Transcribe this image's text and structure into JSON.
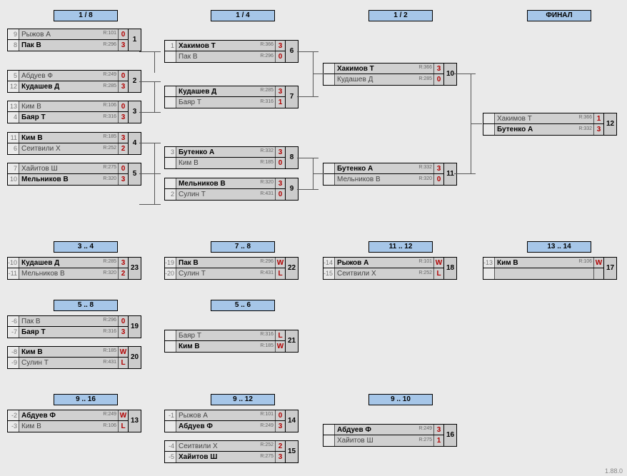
{
  "version": "1.88.0",
  "rounds": {
    "r18": "1 / 8",
    "r14": "1 / 4",
    "r12": "1 / 2",
    "final": "ФИНАЛ",
    "b34": "3 .. 4",
    "b78": "7 .. 8",
    "b1112": "11 .. 12",
    "b1314": "13 .. 14",
    "b58": "5 .. 8",
    "b56": "5 .. 6",
    "b916": "9 .. 16",
    "b912": "9 .. 12",
    "b910": "9 .. 10"
  },
  "matches": {
    "m1": {
      "num": "1",
      "p1": {
        "seed": "9",
        "name": "Рыжов А",
        "r": "R:101",
        "sc": "0",
        "w": false
      },
      "p2": {
        "seed": "8",
        "name": "Пак В",
        "r": "R:296",
        "sc": "3",
        "w": true
      }
    },
    "m2": {
      "num": "2",
      "p1": {
        "seed": "5",
        "name": "Абдуев Ф",
        "r": "R:249",
        "sc": "0",
        "w": false
      },
      "p2": {
        "seed": "12",
        "name": "Кудашев Д",
        "r": "R:285",
        "sc": "3",
        "w": true
      }
    },
    "m3": {
      "num": "3",
      "p1": {
        "seed": "13",
        "name": "Ким В",
        "r": "R:106",
        "sc": "0",
        "w": false
      },
      "p2": {
        "seed": "4",
        "name": "Баяр Т",
        "r": "R:316",
        "sc": "3",
        "w": true
      }
    },
    "m4": {
      "num": "4",
      "p1": {
        "seed": "11",
        "name": "Ким В",
        "r": "R:185",
        "sc": "3",
        "w": true
      },
      "p2": {
        "seed": "6",
        "name": "Сеитвили Х",
        "r": "R:252",
        "sc": "2",
        "w": false
      }
    },
    "m5": {
      "num": "5",
      "p1": {
        "seed": "7",
        "name": "Хайитов Ш",
        "r": "R:275",
        "sc": "0",
        "w": false
      },
      "p2": {
        "seed": "10",
        "name": "Мельников В",
        "r": "R:320",
        "sc": "3",
        "w": true
      }
    },
    "m6": {
      "num": "6",
      "p1": {
        "seed": "1",
        "name": "Хакимов Т",
        "r": "R:366",
        "sc": "3",
        "w": true
      },
      "p2": {
        "seed": "",
        "name": "Пак В",
        "r": "R:296",
        "sc": "0",
        "w": false
      }
    },
    "m7": {
      "num": "7",
      "p1": {
        "seed": "",
        "name": "Кудашев Д",
        "r": "R:285",
        "sc": "3",
        "w": true
      },
      "p2": {
        "seed": "",
        "name": "Баяр Т",
        "r": "R:316",
        "sc": "1",
        "w": false
      }
    },
    "m8": {
      "num": "8",
      "p1": {
        "seed": "3",
        "name": "Бутенко А",
        "r": "R:332",
        "sc": "3",
        "w": true
      },
      "p2": {
        "seed": "",
        "name": "Ким В",
        "r": "R:185",
        "sc": "0",
        "w": false
      }
    },
    "m9": {
      "num": "9",
      "p1": {
        "seed": "",
        "name": "Мельников В",
        "r": "R:320",
        "sc": "3",
        "w": true
      },
      "p2": {
        "seed": "2",
        "name": "Сулин Т",
        "r": "R:431",
        "sc": "0",
        "w": false
      }
    },
    "m10": {
      "num": "10",
      "p1": {
        "seed": "",
        "name": "Хакимов Т",
        "r": "R:366",
        "sc": "3",
        "w": true
      },
      "p2": {
        "seed": "",
        "name": "Кудашев Д",
        "r": "R:285",
        "sc": "0",
        "w": false
      }
    },
    "m11": {
      "num": "11",
      "p1": {
        "seed": "",
        "name": "Бутенко А",
        "r": "R:332",
        "sc": "3",
        "w": true
      },
      "p2": {
        "seed": "",
        "name": "Мельников В",
        "r": "R:320",
        "sc": "0",
        "w": false
      }
    },
    "m12": {
      "num": "12",
      "p1": {
        "seed": "",
        "name": "Хакимов Т",
        "r": "R:366",
        "sc": "1",
        "w": false
      },
      "p2": {
        "seed": "",
        "name": "Бутенко А",
        "r": "R:332",
        "sc": "3",
        "w": true
      }
    },
    "m13": {
      "num": "13",
      "p1": {
        "seed": "-2",
        "name": "Абдуев Ф",
        "r": "R:249",
        "sc": "W",
        "w": true
      },
      "p2": {
        "seed": "-3",
        "name": "Ким В",
        "r": "R:106",
        "sc": "L",
        "w": false
      }
    },
    "m14": {
      "num": "14",
      "p1": {
        "seed": "-1",
        "name": "Рыжов А",
        "r": "R:101",
        "sc": "0",
        "w": false
      },
      "p2": {
        "seed": "",
        "name": "Абдуев Ф",
        "r": "R:249",
        "sc": "3",
        "w": true
      }
    },
    "m15": {
      "num": "15",
      "p1": {
        "seed": "-4",
        "name": "Сеитвили Х",
        "r": "R:252",
        "sc": "2",
        "w": false
      },
      "p2": {
        "seed": "-5",
        "name": "Хайитов Ш",
        "r": "R:275",
        "sc": "3",
        "w": true
      }
    },
    "m16": {
      "num": "16",
      "p1": {
        "seed": "",
        "name": "Абдуев Ф",
        "r": "R:249",
        "sc": "3",
        "w": true
      },
      "p2": {
        "seed": "",
        "name": "Хайитов Ш",
        "r": "R:275",
        "sc": "1",
        "w": false
      }
    },
    "m17": {
      "num": "17",
      "p1": {
        "seed": "-13",
        "name": "Ким В",
        "r": "R:106",
        "sc": "W",
        "w": true
      },
      "p2": {
        "seed": "",
        "name": "",
        "r": "",
        "sc": "",
        "w": false
      }
    },
    "m18": {
      "num": "18",
      "p1": {
        "seed": "-14",
        "name": "Рыжов А",
        "r": "R:101",
        "sc": "W",
        "w": true
      },
      "p2": {
        "seed": "-15",
        "name": "Сеитвили Х",
        "r": "R:252",
        "sc": "L",
        "w": false
      }
    },
    "m19": {
      "num": "19",
      "p1": {
        "seed": "-6",
        "name": "Пак В",
        "r": "R:296",
        "sc": "0",
        "w": false
      },
      "p2": {
        "seed": "-7",
        "name": "Баяр Т",
        "r": "R:316",
        "sc": "3",
        "w": true
      }
    },
    "m20": {
      "num": "20",
      "p1": {
        "seed": "-8",
        "name": "Ким В",
        "r": "R:185",
        "sc": "W",
        "w": true
      },
      "p2": {
        "seed": "-9",
        "name": "Сулин Т",
        "r": "R:431",
        "sc": "L",
        "w": false
      }
    },
    "m21": {
      "num": "21",
      "p1": {
        "seed": "",
        "name": "Баяр Т",
        "r": "R:316",
        "sc": "L",
        "w": false
      },
      "p2": {
        "seed": "",
        "name": "Ким В",
        "r": "R:185",
        "sc": "W",
        "w": true
      }
    },
    "m22": {
      "num": "22",
      "p1": {
        "seed": "-19",
        "name": "Пак В",
        "r": "R:296",
        "sc": "W",
        "w": true
      },
      "p2": {
        "seed": "-20",
        "name": "Сулин Т",
        "r": "R:431",
        "sc": "L",
        "w": false
      }
    },
    "m23": {
      "num": "23",
      "p1": {
        "seed": "-10",
        "name": "Кудашев Д",
        "r": "R:285",
        "sc": "3",
        "w": true
      },
      "p2": {
        "seed": "-11",
        "name": "Мельников В",
        "r": "R:320",
        "sc": "2",
        "w": false
      }
    }
  }
}
